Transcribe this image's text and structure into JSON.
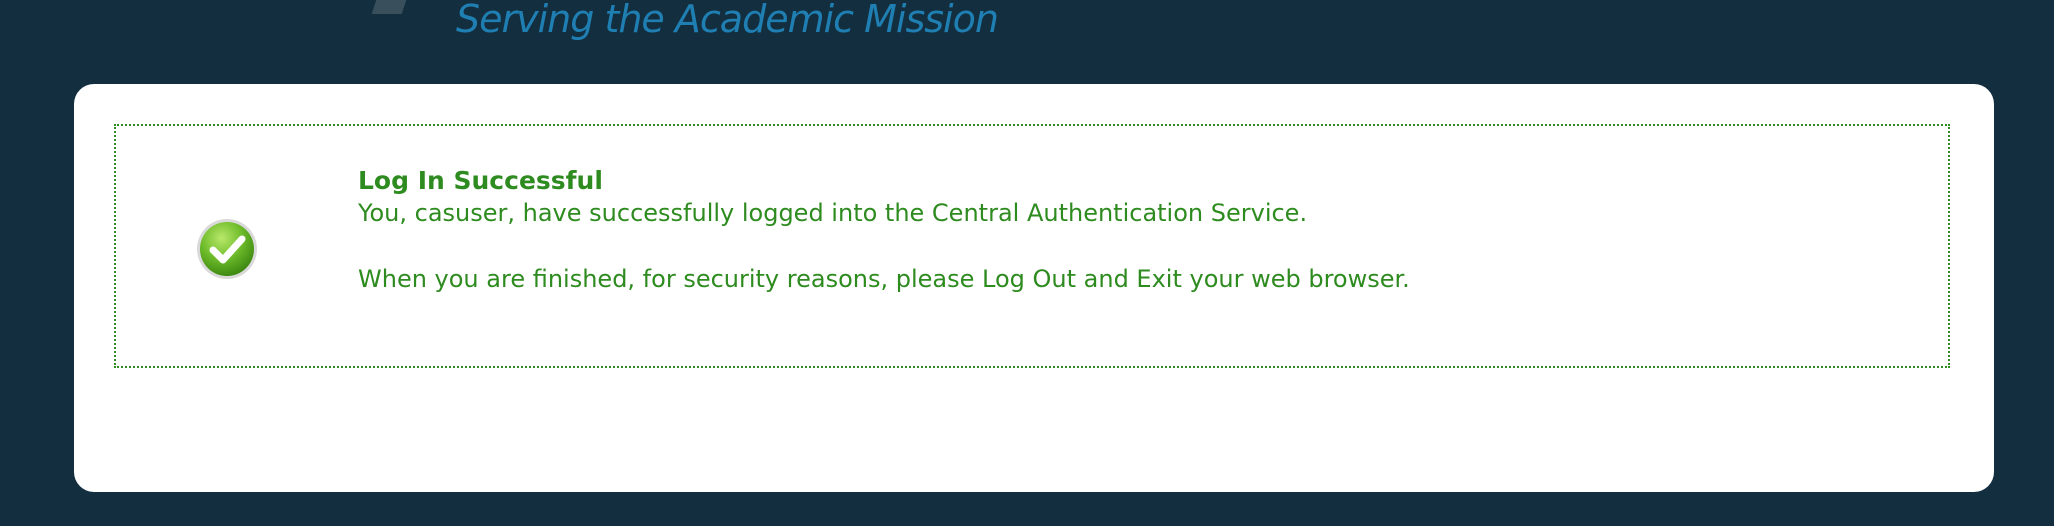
{
  "header": {
    "tagline": "Serving the Academic Mission"
  },
  "message": {
    "title": "Log In Successful",
    "line1": "You, casuser, have successfully logged into the Central Authentication Service.",
    "line2": "When you are finished, for security reasons, please Log Out and Exit your web browser."
  },
  "icons": {
    "status": "check-circle-icon"
  },
  "colors": {
    "background": "#132f3f",
    "success_text": "#2e8b1f",
    "tagline": "#1f7fb3"
  }
}
